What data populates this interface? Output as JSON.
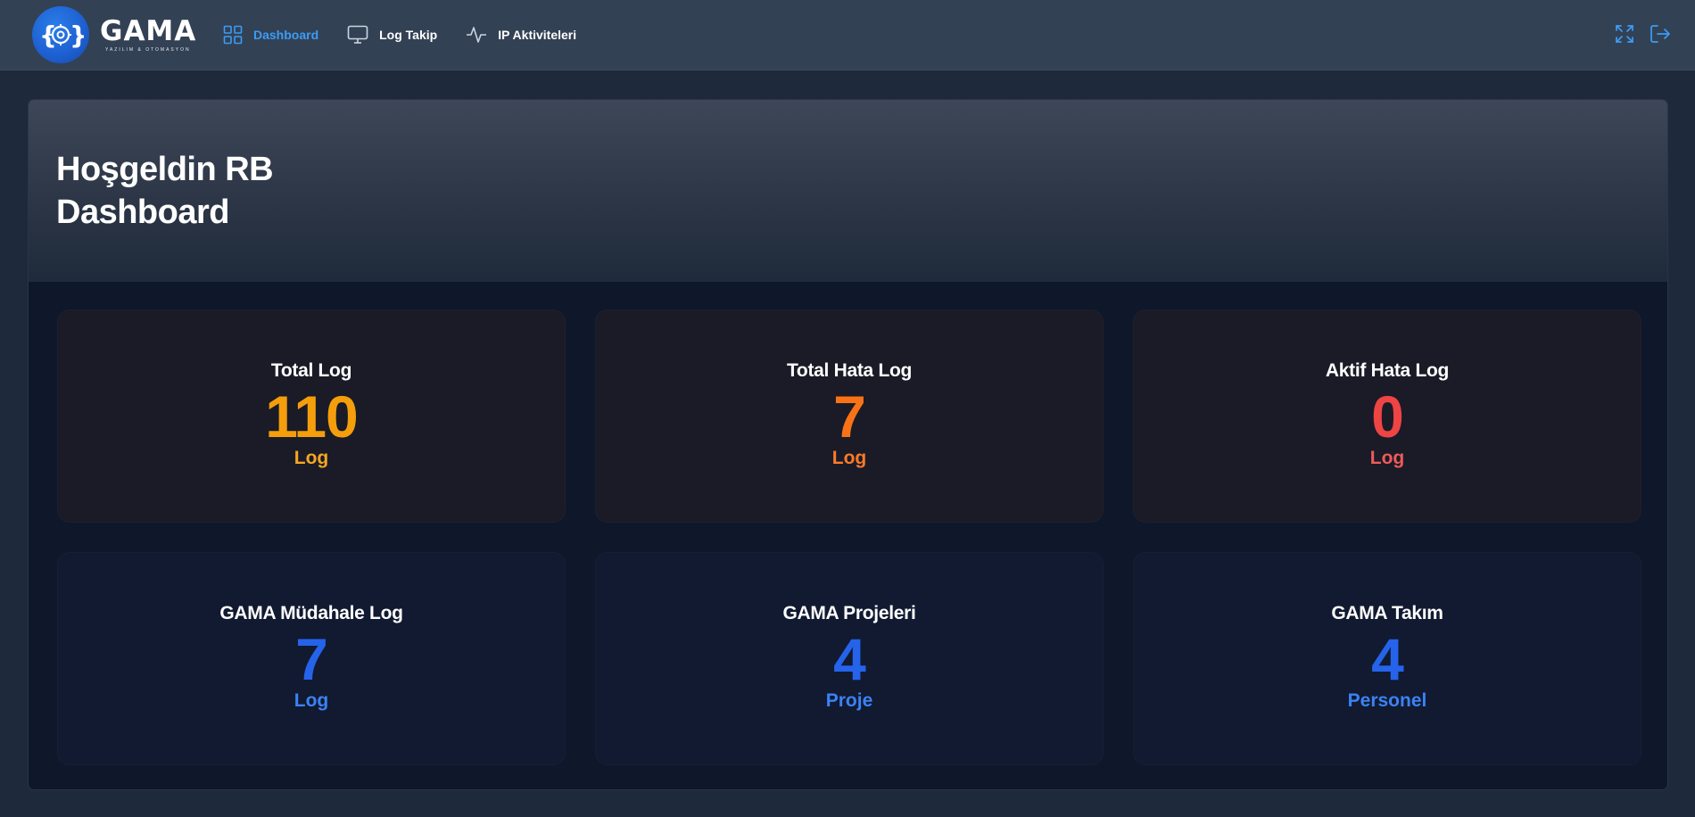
{
  "brand": {
    "name": "GAMA",
    "tagline": "YAZILIM & OTOMASYON",
    "accent": "#1d5fd0"
  },
  "nav": {
    "items": [
      {
        "label": "Dashboard",
        "icon": "grid-icon",
        "active": true
      },
      {
        "label": "Log Takip",
        "icon": "monitor-icon",
        "active": false
      },
      {
        "label": "IP Aktiviteleri",
        "icon": "activity-icon",
        "active": false
      }
    ]
  },
  "actions": {
    "fullscreen_icon": "fullscreen-icon",
    "logout_icon": "logout-icon"
  },
  "hero": {
    "greeting": "Hoşgeldin RB",
    "title": "Dashboard"
  },
  "stats": [
    {
      "title": "Total Log",
      "value": "110",
      "unit": "Log",
      "color": "#f59e0b"
    },
    {
      "title": "Total Hata Log",
      "value": "7",
      "unit": "Log",
      "color": "#f97316"
    },
    {
      "title": "Aktif Hata Log",
      "value": "0",
      "unit": "Log",
      "color": "#ef4444"
    },
    {
      "title": "GAMA Müdahale Log",
      "value": "7",
      "unit": "Log",
      "color": "#2563eb"
    },
    {
      "title": "GAMA Projeleri",
      "value": "4",
      "unit": "Proje",
      "color": "#2563eb"
    },
    {
      "title": "GAMA Takım",
      "value": "4",
      "unit": "Personel",
      "color": "#2563eb"
    }
  ],
  "colors": {
    "topbar": "#334155",
    "page_bg": "#1e293b",
    "card_bg": "#0f172a",
    "nav_active": "#3b9cf5",
    "unit_blue": "#3b82f6"
  }
}
